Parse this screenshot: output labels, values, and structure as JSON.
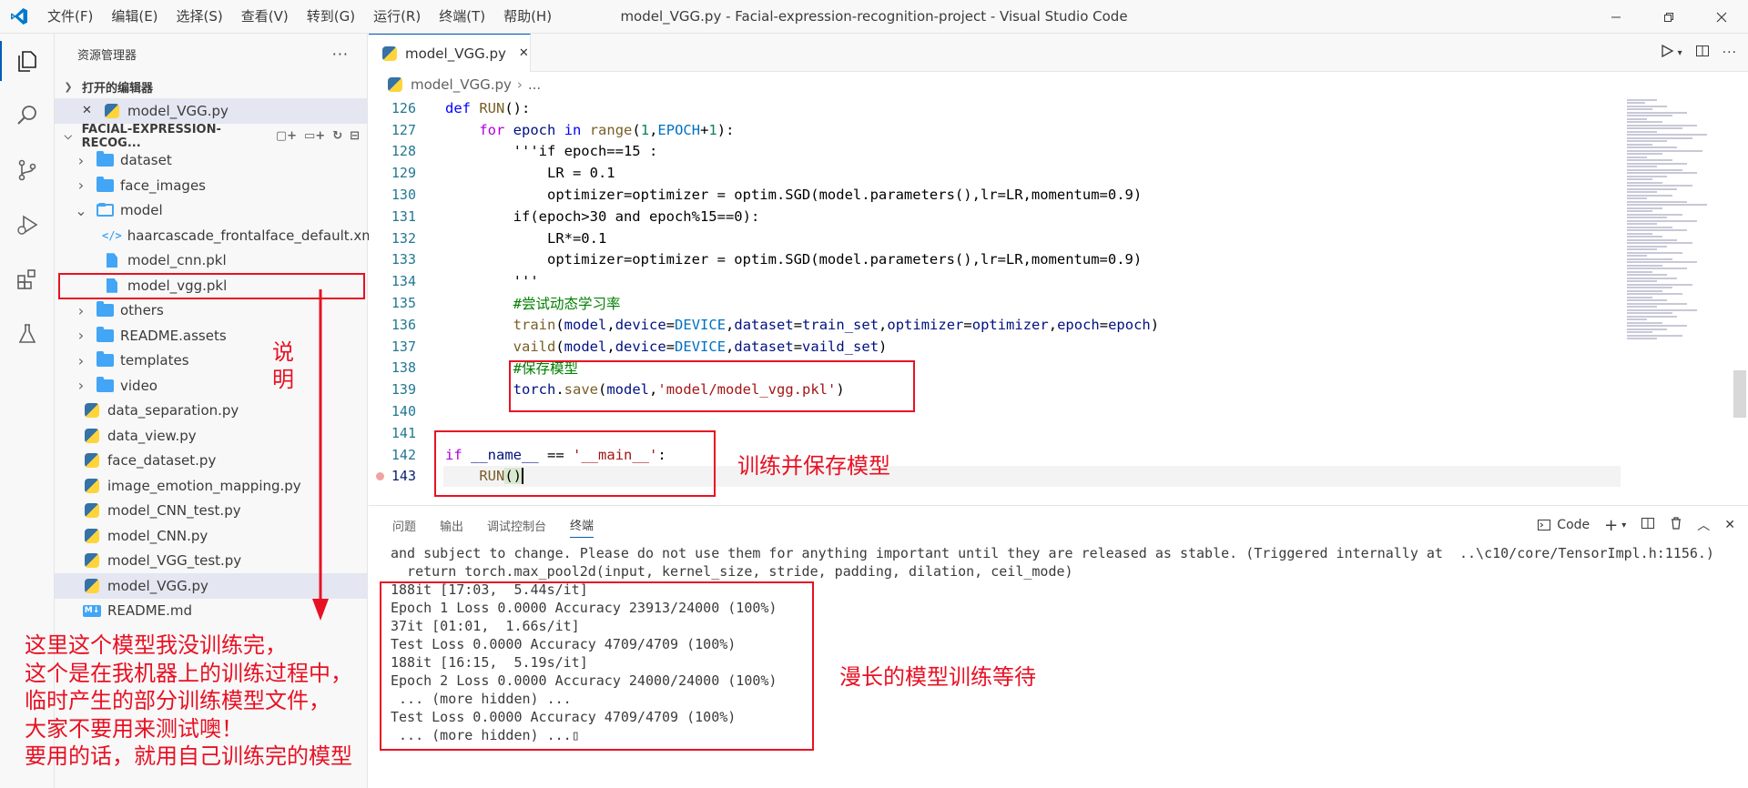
{
  "window": {
    "title": "model_VGG.py - Facial-expression-recognition-project - Visual Studio Code",
    "menu": [
      "文件(F)",
      "编辑(E)",
      "选择(S)",
      "查看(V)",
      "转到(G)",
      "运行(R)",
      "终端(T)",
      "帮助(H)"
    ]
  },
  "activitybar": [
    "explorer-icon",
    "search-icon",
    "source-control-icon",
    "run-debug-icon",
    "extensions-icon",
    "testing-icon"
  ],
  "sidebar": {
    "title": "资源管理器",
    "open_editors_title": "打开的编辑器",
    "open_editor_file": "model_VGG.py",
    "project_title": "FACIAL-EXPRESSION-RECOG...",
    "tree": [
      {
        "label": "dataset",
        "type": "folder"
      },
      {
        "label": "face_images",
        "type": "folder"
      },
      {
        "label": "model",
        "type": "folder-open"
      },
      {
        "label": "haarcascade_frontalface_default.xml",
        "type": "xml"
      },
      {
        "label": "model_cnn.pkl",
        "type": "file"
      },
      {
        "label": "model_vgg.pkl",
        "type": "file"
      },
      {
        "label": "others",
        "type": "folder"
      },
      {
        "label": "README.assets",
        "type": "folder"
      },
      {
        "label": "templates",
        "type": "folder"
      },
      {
        "label": "video",
        "type": "folder"
      },
      {
        "label": "data_separation.py",
        "type": "py"
      },
      {
        "label": "data_view.py",
        "type": "py"
      },
      {
        "label": "face_dataset.py",
        "type": "py"
      },
      {
        "label": "image_emotion_mapping.py",
        "type": "py"
      },
      {
        "label": "model_CNN_test.py",
        "type": "py"
      },
      {
        "label": "model_CNN.py",
        "type": "py"
      },
      {
        "label": "model_VGG_test.py",
        "type": "py"
      },
      {
        "label": "model_VGG.py",
        "type": "py"
      },
      {
        "label": "README.md",
        "type": "md"
      }
    ]
  },
  "editor": {
    "tab": "model_VGG.py",
    "breadcrumb": [
      "model_VGG.py",
      "..."
    ],
    "line_numbers": [
      "126",
      "127",
      "128",
      "129",
      "130",
      "131",
      "132",
      "133",
      "134",
      "135",
      "136",
      "137",
      "138",
      "139",
      "140",
      "141",
      "142",
      "143"
    ]
  },
  "panel": {
    "tabs": [
      "问题",
      "输出",
      "调试控制台",
      "终端"
    ],
    "terminal_label": "Code",
    "lines": [
      "and subject to change. Please do not use them for anything important until they are released as stable. (Triggered internally at  ..\\c10/core/TensorImpl.h:1156.)",
      "  return torch.max_pool2d(input, kernel_size, stride, padding, dilation, ceil_mode)",
      "188it [17:03,  5.44s/it]",
      "Epoch 1 Loss 0.0000 Accuracy 23913/24000 (100%)",
      "37it [01:01,  1.66s/it]",
      "Test Loss 0.0000 Accuracy 4709/4709 (100%)",
      "188it [16:15,  5.19s/it]",
      "Epoch 2 Loss 0.0000 Accuracy 24000/24000 (100%)",
      " ... (more hidden) ...",
      "Test Loss 0.0000 Accuracy 4709/4709 (100%)",
      " ... (more hidden) ...▯"
    ]
  },
  "annotations": {
    "shuo_ming": "说\n明",
    "train_save": "训练并保存模型",
    "long_wait": "漫长的模型训练等待",
    "note_lines": [
      "这里这个模型我没训练完，",
      "这个是在我机器上的训练过程中，",
      "临时产生的部分训练模型文件，",
      "大家不要用来测试噢！",
      "要用的话，就用自己训练完的模型"
    ]
  },
  "colors": {
    "annotation_red": "#e81123",
    "accent": "#005fb8"
  }
}
